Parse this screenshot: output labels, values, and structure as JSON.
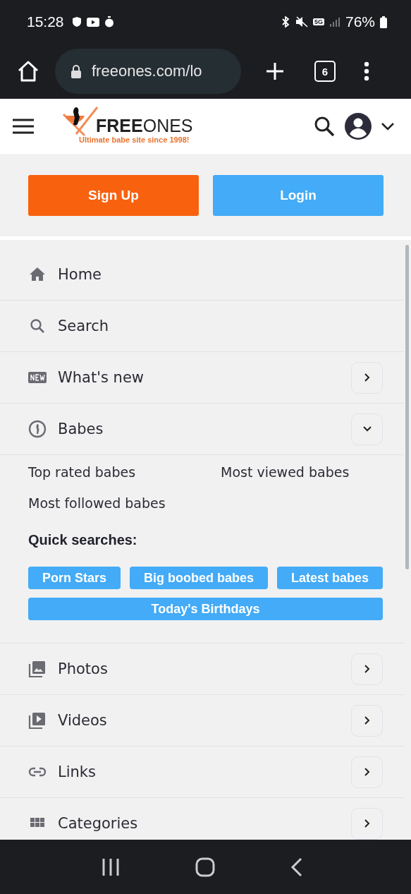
{
  "status_bar": {
    "time": "15:28",
    "network": "5G",
    "battery": "76%"
  },
  "browser": {
    "url": "freeones.com/lo",
    "tab_count": "6"
  },
  "header": {
    "logo": "**FREE**ONES",
    "tagline": "Ultimate babe site since 1998!"
  },
  "auth_buttons": [
    {
      "label": "Sign Up",
      "kind": "primary"
    },
    {
      "label": "Login",
      "kind": "secondary"
    }
  ],
  "menu": [
    {
      "label": "Home",
      "kind": "plain"
    },
    {
      "label": "Search",
      "kind": "plain"
    },
    {
      "label": "What's new",
      "kind": "expandable",
      "expanded": false
    },
    {
      "label": "Babes",
      "kind": "expandable",
      "expanded": true,
      "links": [
        "Top rated babes",
        "Most viewed babes",
        "Most followed babes"
      ],
      "quick_title": "Quick searches:",
      "quick_searches": [
        "Porn Stars",
        "Big boobed babes",
        "Latest babes",
        "Today's Birthdays"
      ]
    },
    {
      "label": "Photos",
      "kind": "expandable",
      "expanded": false
    },
    {
      "label": "Videos",
      "kind": "expandable",
      "expanded": false
    },
    {
      "label": "Links",
      "kind": "expandable",
      "expanded": false
    },
    {
      "label": "Categories",
      "kind": "expandable",
      "expanded": false
    }
  ]
}
